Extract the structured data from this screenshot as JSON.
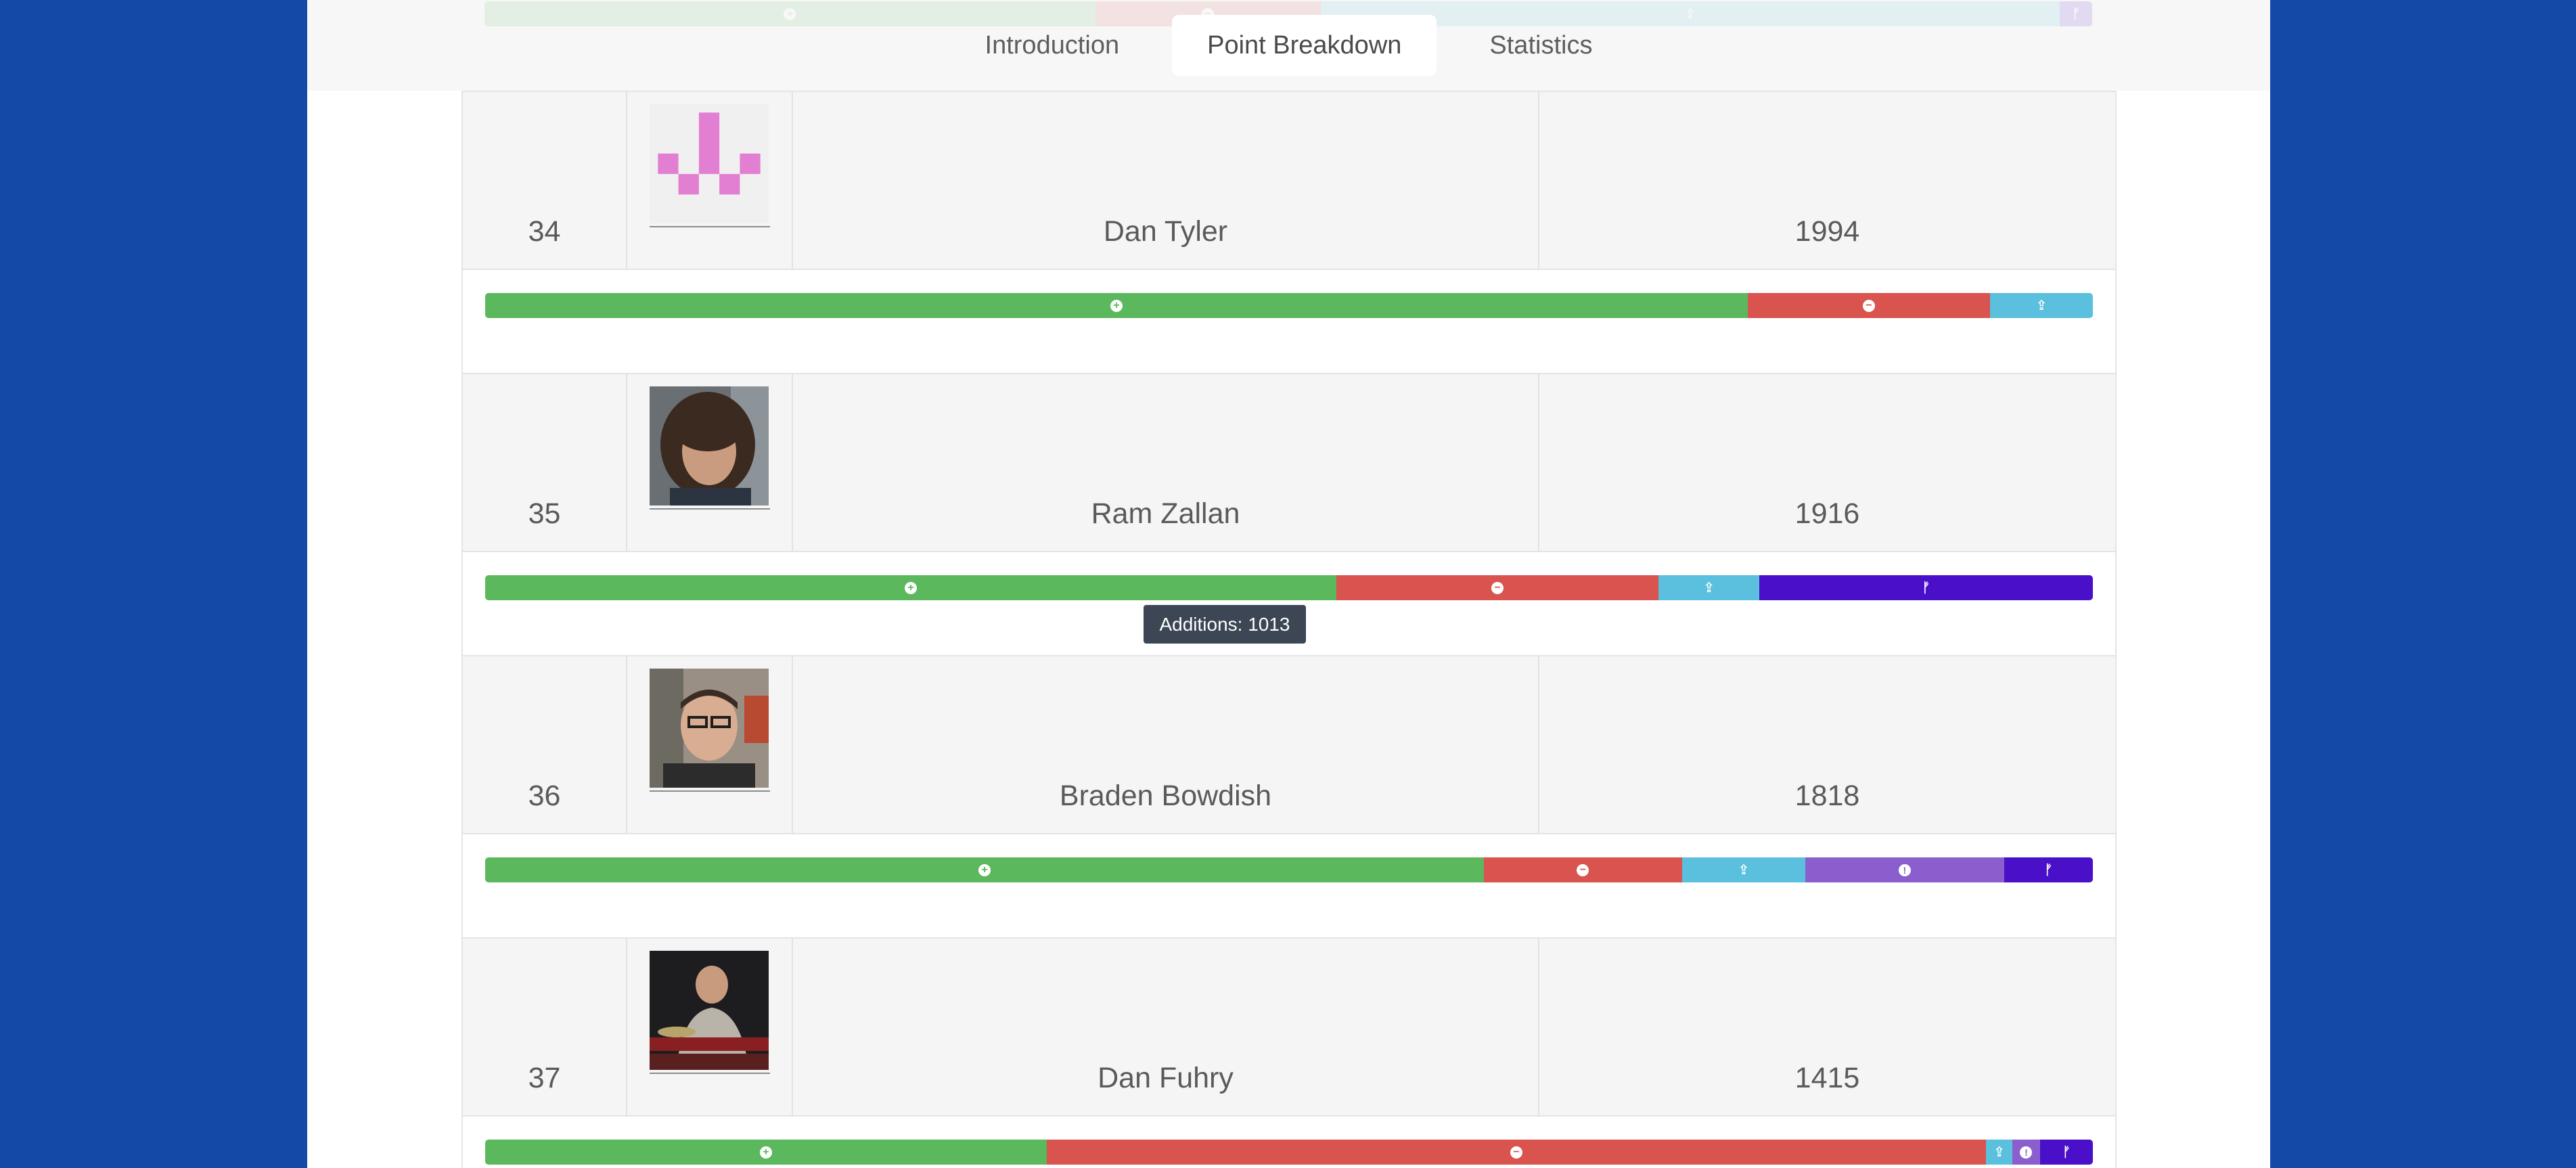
{
  "tabs": [
    {
      "label": "Introduction",
      "active": false
    },
    {
      "label": "Point Breakdown",
      "active": true
    },
    {
      "label": "Statistics",
      "active": false
    }
  ],
  "header_bar": {
    "segments": [
      {
        "type": "additions",
        "fraction": 0.38
      },
      {
        "type": "deletions",
        "fraction": 0.14
      },
      {
        "type": "commits",
        "fraction": 0.46
      },
      {
        "type": "pull_requests",
        "fraction": 0.02
      }
    ]
  },
  "legend_icons": {
    "additions": "plus-circle-icon",
    "deletions": "minus-circle-icon",
    "commits": "upload-icon",
    "issues": "exclamation-circle-icon",
    "pull_requests": "pull-request-icon"
  },
  "colors": {
    "background": "#1449a8",
    "additions": "#5cb85c",
    "deletions": "#d9534f",
    "commits": "#5bc0de",
    "issues": "#8a5fcd",
    "pull_requests": "#4a0fc8",
    "tooltip": "#3c4654"
  },
  "rows": [
    {
      "rank": "34",
      "name": "Dan Tyler",
      "score": "1994",
      "avatar": "identicon",
      "segments": [
        {
          "type": "additions",
          "fraction": 0.7853
        },
        {
          "type": "deletions",
          "fraction": 0.1507
        },
        {
          "type": "commits",
          "fraction": 0.064
        }
      ]
    },
    {
      "rank": "35",
      "name": "Ram Zallan",
      "score": "1916",
      "avatar": "photo-curly-hair",
      "segments": [
        {
          "type": "additions",
          "fraction": 0.5295
        },
        {
          "type": "deletions",
          "fraction": 0.2003
        },
        {
          "type": "commits",
          "fraction": 0.0627
        },
        {
          "type": "pull_requests",
          "fraction": 0.2075
        }
      ]
    },
    {
      "rank": "36",
      "name": "Braden Bowdish",
      "score": "1818",
      "avatar": "photo-glasses",
      "segments": [
        {
          "type": "additions",
          "fraction": 0.6212
        },
        {
          "type": "deletions",
          "fraction": 0.1233
        },
        {
          "type": "commits",
          "fraction": 0.0766
        },
        {
          "type": "issues",
          "fraction": 0.1237
        },
        {
          "type": "pull_requests",
          "fraction": 0.0552
        }
      ]
    },
    {
      "rank": "37",
      "name": "Dan Fuhry",
      "score": "1415",
      "avatar": "photo-drummer",
      "segments": [
        {
          "type": "additions",
          "fraction": 0.3493
        },
        {
          "type": "deletions",
          "fraction": 0.5842
        },
        {
          "type": "commits",
          "fraction": 0.0164
        },
        {
          "type": "issues",
          "fraction": 0.0173
        },
        {
          "type": "pull_requests",
          "fraction": 0.0328
        }
      ]
    }
  ],
  "tooltip": {
    "text": "Additions: 1013"
  }
}
